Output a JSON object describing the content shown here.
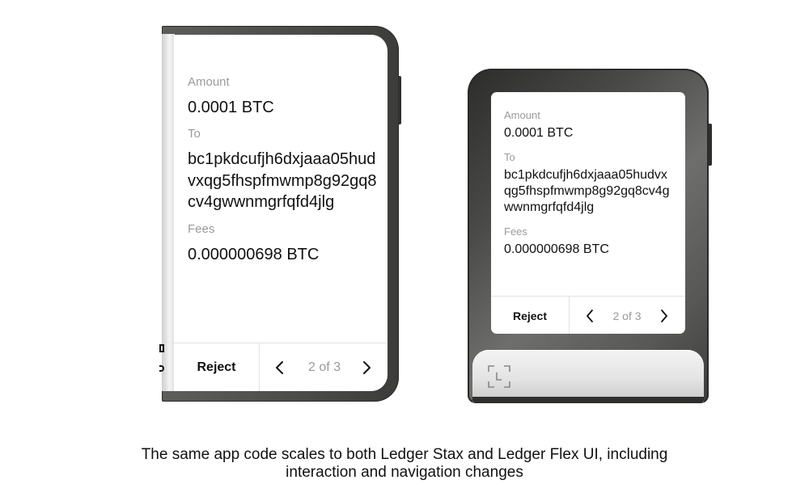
{
  "stax": {
    "device_name": "Ledger Stax",
    "amount_label": "Amount",
    "amount_value": "0.0001 BTC",
    "to_label": "To",
    "to_value": "bc1pkdcufjh6dxjaaa05hudvxqg5fhspfmwmp8g92gq8cv4gwwnmgrfqfd4jlg",
    "fees_label": "Fees",
    "fees_value": "0.000000698 BTC",
    "reject_label": "Reject",
    "page_indicator": "2 of 3",
    "prev_icon": "chevron-left-icon",
    "next_icon": "chevron-right-icon"
  },
  "flex": {
    "device_name": "Ledger Flex",
    "amount_label": "Amount",
    "amount_value": "0.0001 BTC",
    "to_label": "To",
    "to_value": "bc1pkdcufjh6dxjaaa05hudvxqg5fhspfmwmp8g92gq8cv4gwwnmgrfqfd4jlg",
    "fees_label": "Fees",
    "fees_value": "0.000000698 BTC",
    "reject_label": "Reject",
    "page_indicator": "2 of 3",
    "prev_icon": "chevron-left-icon",
    "next_icon": "chevron-right-icon",
    "scan_icon": "scan-frame-icon"
  },
  "caption": {
    "line1": "The same app code scales to both Ledger Stax and Ledger Flex UI, including",
    "line2": "interaction and navigation changes"
  },
  "colors": {
    "device_dark": "#4c4c4a",
    "muted_text": "#9a9a9a",
    "divider": "#e2e2e2",
    "text": "#111111"
  }
}
